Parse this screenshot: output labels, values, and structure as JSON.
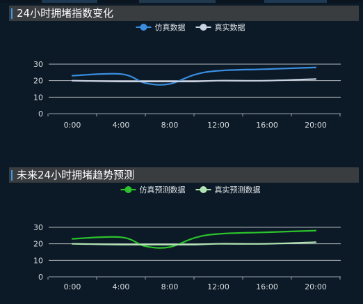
{
  "colors": {
    "background": "#0c1a27",
    "header_bg": "#3a3d40",
    "header_accent": "#3c98e6",
    "axis": "#9aa6b2",
    "grid": "#d0d4d8",
    "tick_text": "#d8dde2",
    "legend_text": "#e0e4e8"
  },
  "chart_data": [
    {
      "type": "line",
      "title": "24小时拥堵指数变化",
      "x": [
        "0:00",
        "4:00",
        "8:00",
        "12:00",
        "16:00",
        "20:00"
      ],
      "xlabel": "",
      "ylabel": "",
      "ylim": [
        0,
        30
      ],
      "yticks": [
        0,
        10,
        20,
        30
      ],
      "grid": true,
      "legend_position": "top-center",
      "series": [
        {
          "name": "仿真数据",
          "color": "#3a8ee0",
          "x": [
            0,
            1,
            1.5,
            2,
            2.5,
            3,
            4,
            5
          ],
          "values": [
            23,
            24,
            18.5,
            18,
            23.5,
            26,
            27,
            28
          ]
        },
        {
          "name": "真实数据",
          "color": "#c9d2e2",
          "x": [
            0,
            1,
            1.5,
            2,
            2.5,
            3,
            4,
            5
          ],
          "values": [
            20,
            19.5,
            19.5,
            19.5,
            19.5,
            20,
            20,
            21
          ]
        }
      ]
    },
    {
      "type": "line",
      "title": "未来24小时拥堵趋势预测",
      "x": [
        "0:00",
        "4:00",
        "8:00",
        "12:00",
        "16:00",
        "20:00"
      ],
      "xlabel": "",
      "ylabel": "",
      "ylim": [
        0,
        30
      ],
      "yticks": [
        0,
        10,
        20,
        30
      ],
      "grid": true,
      "legend_position": "top-center",
      "series": [
        {
          "name": "仿真预测数据",
          "color": "#2cc22c",
          "x": [
            0,
            1,
            1.5,
            2,
            2.5,
            3,
            4,
            5
          ],
          "values": [
            23,
            24,
            18.5,
            18,
            23.5,
            26,
            27,
            28
          ]
        },
        {
          "name": "真实预测数据",
          "color": "#b2e3b2",
          "x": [
            0,
            1,
            1.5,
            2,
            2.5,
            3,
            4,
            5
          ],
          "values": [
            20,
            19.5,
            19.5,
            19.5,
            19.5,
            20,
            20,
            21
          ]
        }
      ]
    }
  ]
}
